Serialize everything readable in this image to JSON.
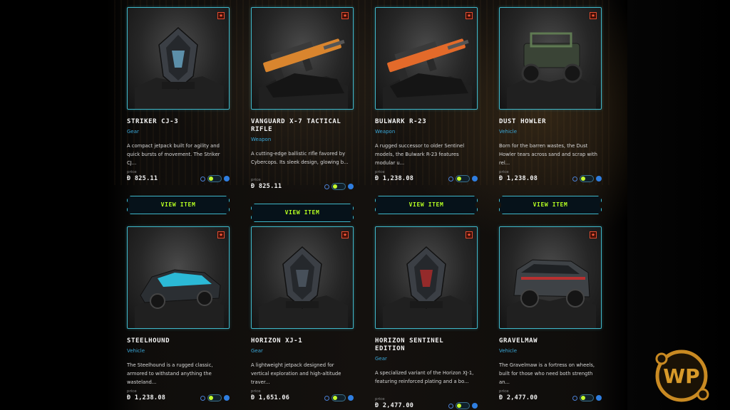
{
  "items": [
    {
      "name": "STRIKER CJ-3",
      "category": "Gear",
      "description": "A compact jetpack built for agility and quick bursts of movement. The Striker CJ...",
      "price_label": "price",
      "price": "Ð 825.11",
      "button": "VIEW ITEM",
      "thumb": "jetpack",
      "accent": "#6aa9c9"
    },
    {
      "name": "VANGUARD X-7 TACTICAL RIFLE",
      "category": "Weapon",
      "description": "A cutting-edge ballistic rifle favored by Cybercops. Its sleek design, glowing b...",
      "price_label": "price",
      "price": "Ð 825.11",
      "button": "VIEW ITEM",
      "thumb": "rifle",
      "accent": "#d9852e"
    },
    {
      "name": "BULWARK R-23",
      "category": "Weapon",
      "description": "A rugged successor to older Sentinel models, the Bulwark R-23 features modular u...",
      "price_label": "price",
      "price": "Ð 1,238.08",
      "button": "VIEW ITEM",
      "thumb": "rifle",
      "accent": "#e36a2a"
    },
    {
      "name": "DUST HOWLER",
      "category": "Vehicle",
      "description": "Born for the barren wastes, the Dust Howler tears across sand and scrap with rel...",
      "price_label": "price",
      "price": "Ð 1,238.08",
      "button": "VIEW ITEM",
      "thumb": "buggy",
      "accent": "#5f7a52"
    },
    {
      "name": "STEELHOUND",
      "category": "Vehicle",
      "description": "The Steelhound is a rugged classic, armored to withstand anything the wasteland...",
      "price_label": "price",
      "price": "Ð 1,238.08",
      "thumb": "car",
      "accent": "#2bb9d6"
    },
    {
      "name": "HORIZON XJ-1",
      "category": "Gear",
      "description": "A lightweight jetpack designed for vertical exploration and high-altitude traver...",
      "price_label": "price",
      "price": "Ð 1,651.06",
      "thumb": "jetpack",
      "accent": "#505a66"
    },
    {
      "name": "HORIZON SENTINEL EDITION",
      "category": "Gear",
      "description": "A specialized variant of the Horizon XJ-1, featuring reinforced plating and a bo...",
      "price_label": "price",
      "price": "Ð 2,477.00",
      "thumb": "jetpack",
      "accent": "#b02a2a"
    },
    {
      "name": "GRAVELMAW",
      "category": "Vehicle",
      "description": "The Gravelmaw is a fortress on wheels, built for those who need both strength an...",
      "price_label": "price",
      "price": "Ð 2,477.00",
      "thumb": "truck",
      "accent": "#b83030"
    }
  ],
  "icons": {
    "favorite": "bookmark-star-icon",
    "compare": "compare-icon",
    "toggle": "toggle-switch",
    "info": "info-icon"
  },
  "colors": {
    "cyan_border": "#3fb7c9",
    "lime_text": "#b6ff22",
    "category_blue": "#3aa7d8",
    "favorite_red": "#e24b2f"
  },
  "watermark": {
    "text": "WP"
  }
}
